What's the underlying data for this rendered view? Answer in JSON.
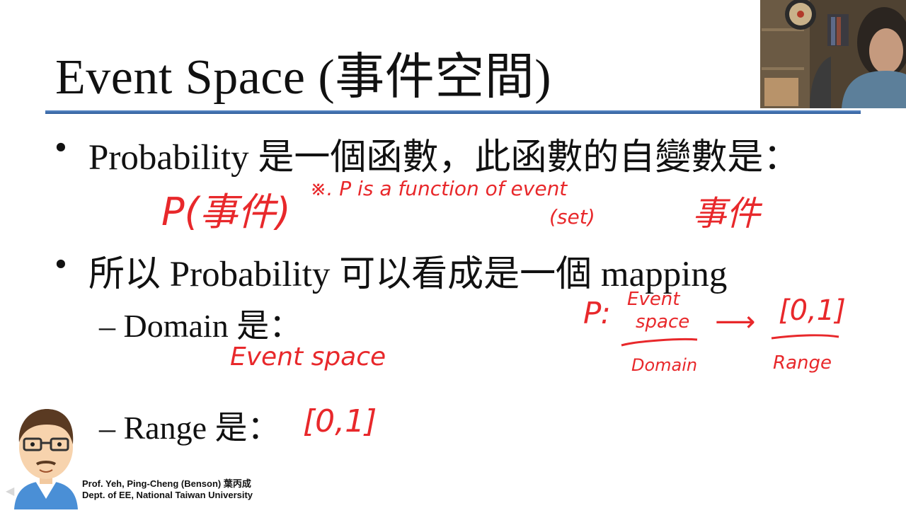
{
  "slide": {
    "title": "Event Space (事件空間)",
    "bullets": [
      {
        "symbol": "•",
        "text": "Probability 是一個函數，此函數的自變數是："
      },
      {
        "symbol": "•",
        "text": "所以 Probability 可以看成是一個 mapping"
      }
    ],
    "subbullets": [
      {
        "symbol": "–",
        "text": "Domain 是："
      },
      {
        "symbol": "–",
        "text": "Range 是："
      }
    ],
    "credit": {
      "line1": "Prof. Yeh, Ping-Cheng (Benson) 葉丙成",
      "line2": "Dept. of EE,  National Taiwan University"
    }
  },
  "annotations": {
    "p_event": "P(事件)",
    "note": "※. P is a function of event",
    "set": "(set)",
    "event_word": "事件",
    "domain_answer": "Event space",
    "range_answer": "[0,1]",
    "map_p": "P:",
    "map_event": "Event",
    "map_space": "space",
    "map_arrow": "⟶",
    "map_range": "[0,1]",
    "map_domain_label": "Domain",
    "map_range_label": "Range"
  },
  "colors": {
    "ink": "#e8282b",
    "title_rule": "#3a6aa8",
    "text": "#111111"
  },
  "icons": [
    "webcam-feed",
    "cartoon-avatar",
    "nav-back-icon"
  ]
}
